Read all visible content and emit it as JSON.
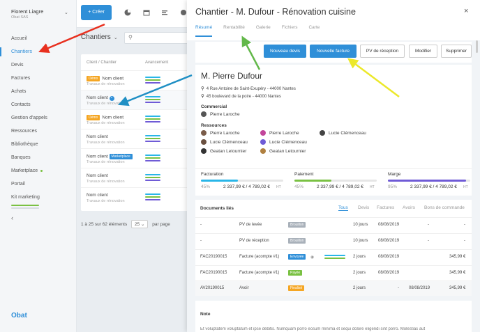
{
  "sidebar": {
    "user_name": "Florent Liagre",
    "company": "Obat SAS",
    "items": [
      {
        "label": "Accueil"
      },
      {
        "label": "Chantiers"
      },
      {
        "label": "Devis"
      },
      {
        "label": "Factures"
      },
      {
        "label": "Achats"
      },
      {
        "label": "Contacts"
      },
      {
        "label": "Gestion d'appels"
      },
      {
        "label": "Ressources"
      },
      {
        "label": "Bibliothèque"
      },
      {
        "label": "Banques"
      },
      {
        "label": "Marketplace"
      },
      {
        "label": "Portail"
      },
      {
        "label": "Kit marketing"
      }
    ],
    "logo": "Obat"
  },
  "topbar": {
    "create_label": "Créer"
  },
  "list": {
    "title": "Chantiers",
    "columns": [
      "Client / Chantier",
      "Avancement"
    ],
    "rows": [
      {
        "badge": "Démo",
        "name": "Nom client",
        "sub": "Travaux de rénovation"
      },
      {
        "badge": "",
        "name": "Nom client",
        "sub": "Travaux de rénovation"
      },
      {
        "badge": "Démo",
        "name": "Nom client",
        "sub": "Travaux de rénovation"
      },
      {
        "badge": "",
        "name": "Nom client",
        "sub": "Travaux de rénovation"
      },
      {
        "badge": "Marketplace",
        "name": "Nom client",
        "sub": "Travaux de rénovation"
      },
      {
        "badge": "",
        "name": "Nom client",
        "sub": "Travaux de rénovation"
      },
      {
        "badge": "",
        "name": "Nom client",
        "sub": "Travaux de rénovation"
      }
    ],
    "pager_text": "1 à 25 sur 62 éléments",
    "per_page": "25",
    "per_page_label": "par page"
  },
  "panel": {
    "title": "Chantier - M. Dufour - Rénovation cuisine",
    "tabs": [
      "Résumé",
      "Rentabilité",
      "Galerie",
      "Fichiers",
      "Carte"
    ],
    "actions": [
      "Nouveau devis",
      "Nouvelle facture",
      "PV de réception",
      "Modifier",
      "Supprimer"
    ],
    "client": {
      "name": "M. Pierre Dufour",
      "addr1": "4 Rue Antoine de Saint-Exupéry - 44000 Nantes",
      "addr2": "45 boulevard de la poire - 44000 Nantes",
      "commercial_label": "Commercial",
      "commercial": "Pierre Laroche",
      "resources_label": "Ressources",
      "resources": [
        "Pierre Laroche",
        "Pierre Laroche",
        "Lucie Clémenceau",
        "Lucie Clémenceau",
        "Lucie Clémenceau",
        "Geatan Letournier",
        "Geatan Letournier"
      ]
    },
    "stats": [
      {
        "label": "Facturation",
        "pct": "45%",
        "amount": "2 337,99 € / 4 789,02 €",
        "ht": "HT",
        "fill": 0.45,
        "color": "#29b6e8"
      },
      {
        "label": "Paiement",
        "pct": "45%",
        "amount": "2 337,99 € / 4 789,02 €",
        "ht": "HT",
        "fill": 0.45,
        "color": "#7ac143"
      },
      {
        "label": "Marge",
        "pct": "95%",
        "amount": "2 337,99 € / 4 789,02 €",
        "ht": "HT",
        "fill": 0.95,
        "color": "#6f5bd6"
      }
    ],
    "documents": {
      "title": "Documents liés",
      "tabs": [
        "Tous",
        "Devis",
        "Factures",
        "Avoirs",
        "Bons de commande"
      ],
      "rows": [
        {
          "num": "-",
          "type": "PV de levée",
          "status": "Brouillon",
          "status_color": "#a9b1ba",
          "delay": "10 jours",
          "date": "08/08/2019",
          "amount": "-",
          "amount2": "-"
        },
        {
          "num": "-",
          "type": "PV de réception",
          "status": "Brouillon",
          "status_color": "#a9b1ba",
          "delay": "10 jours",
          "date": "08/08/2019",
          "amount": "-",
          "amount2": "-"
        },
        {
          "num": "FAC20190015",
          "type": "Facture (acompte #1)",
          "status": "Envoyée",
          "status_color": "#2f8fd8",
          "delay": "2 jours",
          "date": "08/08/2019",
          "amount": "",
          "amount2": "345,99 €"
        },
        {
          "num": "FAC20190015",
          "type": "Facture (acompte #1)",
          "status": "Payée",
          "status_color": "#7ac143",
          "delay": "2 jours",
          "date": "08/08/2019",
          "amount": "",
          "amount2": "345,99 €"
        },
        {
          "num": "AV20190015",
          "type": "Avoir",
          "status": "Finalisé",
          "status_color": "#f5a623",
          "delay": "2 jours",
          "date": "08/08/2019",
          "amount": "-",
          "amount2": "345,99 €"
        }
      ]
    },
    "note": {
      "title": "Note",
      "text": "Et voluptatem voluptatum et ipse debitis. Numquam porro eosum minima et sequi dolore eligendi sint porro. Molestias aut"
    }
  }
}
